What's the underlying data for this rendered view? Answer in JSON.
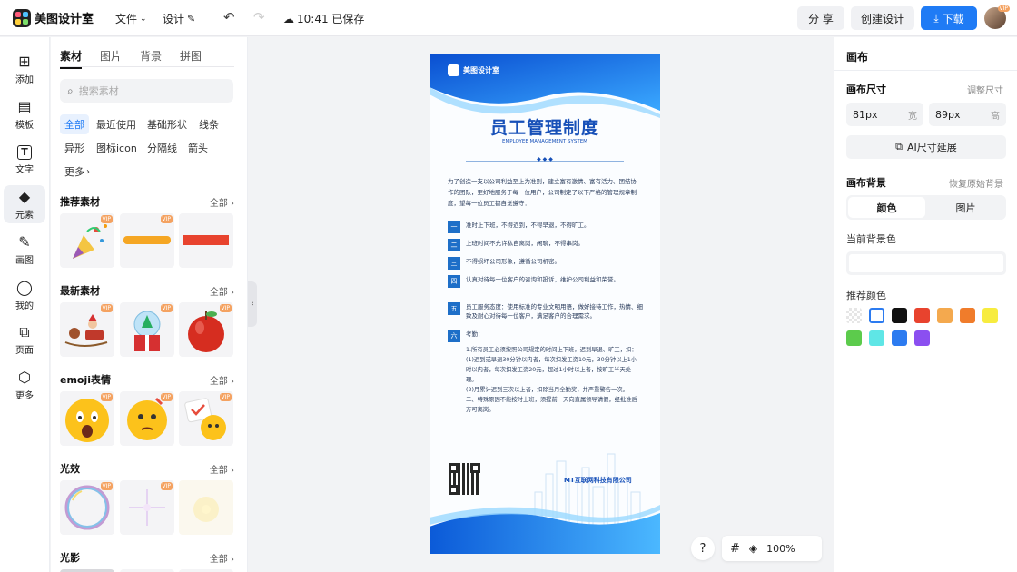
{
  "topbar": {
    "logo_text": "美图设计室",
    "file_label": "文件",
    "design_label": "设计",
    "save_status": "10:41 已保存",
    "share_label": "分 享",
    "create_label": "创建设计",
    "download_label": "下载",
    "avatar_badge": "VIP"
  },
  "leftnav": {
    "items": [
      {
        "label": "添加",
        "icon": "plus-square-icon"
      },
      {
        "label": "模板",
        "icon": "template-icon"
      },
      {
        "label": "文字",
        "icon": "text-icon"
      },
      {
        "label": "元素",
        "icon": "shapes-icon"
      },
      {
        "label": "画图",
        "icon": "pen-icon"
      },
      {
        "label": "我的",
        "icon": "user-icon"
      },
      {
        "label": "页面",
        "icon": "page-add-icon"
      },
      {
        "label": "更多",
        "icon": "cube-icon"
      }
    ]
  },
  "panel": {
    "tabs": [
      "素材",
      "图片",
      "背景",
      "拼图"
    ],
    "search_placeholder": "搜索素材",
    "chips": [
      "全部",
      "最近使用",
      "基础形状",
      "线条",
      "异形",
      "图标icon",
      "分隔线",
      "箭头",
      "更多"
    ],
    "all_label": "全部",
    "vip_label": "VIP",
    "sections": [
      {
        "title": "推荐素材"
      },
      {
        "title": "最新素材"
      },
      {
        "title": "emoji表情"
      },
      {
        "title": "光效"
      },
      {
        "title": "光影"
      }
    ]
  },
  "poster": {
    "brand": "美图设计室",
    "title": "员工管理制度",
    "subtitle": "EMPLOYEE MANAGEMENT SYSTEM",
    "intro": "为了创造一支以公司利益至上为准则，建立富有激情、富有活力、团结协作的团队，更好地服务于每一位用户，公司制定了以下严格的管理规章制度，望每一位员工都自觉遵守：",
    "items": [
      {
        "num": "一",
        "text": "准时上下班，不得迟到，不得早退，不得旷工。"
      },
      {
        "num": "二",
        "text": "上班时间不允许私自离岗，闲聊，不得串岗。"
      },
      {
        "num": "三",
        "text": "不得损坏公司形象，遵循公司机密。"
      },
      {
        "num": "四",
        "text": "认真对待每一位客户的咨询和投诉，维护公司利益和荣誉。"
      },
      {
        "num": "五",
        "text": "员工服务态度：使用标准的专业文明用语，做好接待工作，热情、细致及耐心对待每一位客户，满足客户的合理需求。"
      },
      {
        "num": "六",
        "text": "考勤："
      }
    ],
    "attendance": "1.所有员工必须按照公司规定的时间上下班，迟到早退、旷工，扣：\n(1)迟到或早退30分钟以内者，每次扣发工资10元，30分钟以上1小时以内者，每次扣发工资20元，超过1小时以上者，按旷工半天处理。\n(2)月累计迟到三次以上者，扣除当月全勤奖，并严重警告一次。\n二、特殊原因不能按时上班，须提前一天向直属领导请假，经批准后方可离岗。",
    "company": "MT互联网科技有限公司"
  },
  "zoom": {
    "help": "?",
    "level": "100%"
  },
  "rightpanel": {
    "title": "画布",
    "size_label": "画布尺寸",
    "adjust_label": "调整尺寸",
    "width_value": "81px",
    "width_unit": "宽",
    "height_value": "89px",
    "height_unit": "高",
    "ai_extend_label": "AI尺寸延展",
    "bg_label": "画布背景",
    "restore_label": "恢复原始背景",
    "tab_color": "颜色",
    "tab_image": "图片",
    "current_bg_label": "当前背景色",
    "recommend_label": "推荐颜色",
    "colors": [
      "transparent",
      "#ffffff",
      "#111111",
      "#e8432e",
      "#f4a94e",
      "#f07c2b",
      "#f7ec3f",
      "#5ccb4c",
      "#5fe6e6",
      "#2c7bf0",
      "#8b4ff0"
    ]
  }
}
